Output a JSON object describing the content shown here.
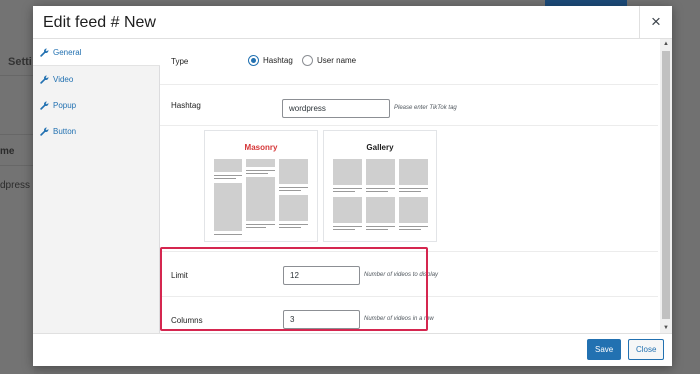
{
  "background": {
    "settings_text": "Setti",
    "name_text": "me",
    "wordpress_text": "dpress"
  },
  "modal": {
    "title": "Edit feed # New",
    "close_glyph": "×"
  },
  "sidebar": {
    "items": [
      {
        "label": "General",
        "icon": "wrench-icon",
        "active": true
      },
      {
        "label": "Video",
        "icon": "wrench-icon",
        "active": false
      },
      {
        "label": "Popup",
        "icon": "wrench-icon",
        "active": false
      },
      {
        "label": "Button",
        "icon": "wrench-icon",
        "active": false
      }
    ]
  },
  "form": {
    "type": {
      "label": "Type",
      "options": [
        {
          "label": "Hashtag",
          "selected": true
        },
        {
          "label": "User name",
          "selected": false
        }
      ]
    },
    "hashtag": {
      "label": "Hashtag",
      "value": "wordpress",
      "hint": "Please enter TikTok tag"
    },
    "layouts": [
      {
        "name": "Masonry",
        "selected": true
      },
      {
        "name": "Gallery",
        "selected": false
      }
    ],
    "limit": {
      "label": "Limit",
      "value": "12",
      "hint": "Number of videos to display"
    },
    "columns": {
      "label": "Columns",
      "value": "3",
      "hint": "Number of videos in a row"
    }
  },
  "footer": {
    "save_label": "Save",
    "close_label": "Close"
  },
  "colors": {
    "accent": "#2271b1",
    "highlight": "#d5264f",
    "masonry_title": "#d63638"
  }
}
